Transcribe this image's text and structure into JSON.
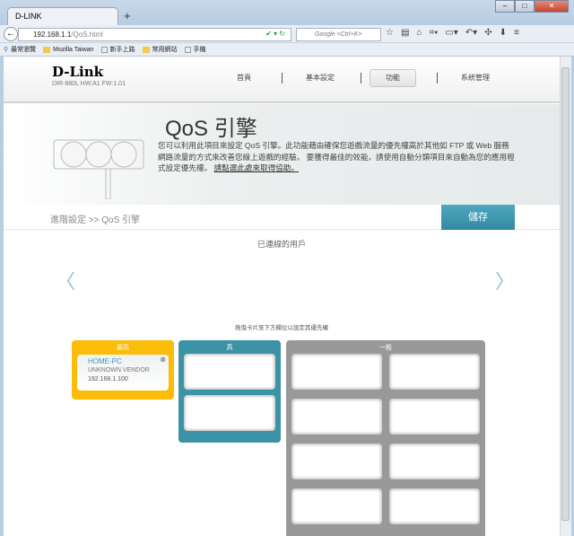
{
  "browser": {
    "tab_title": "D-LINK",
    "url_host": "192.168.1.1",
    "url_path": "/QoS.html",
    "search_placeholder": "Google <Ctrl+K>",
    "bookmarks": [
      "最常瀏覽",
      "Mozilla Taiwan",
      "新手上路",
      "常用網站",
      "手機"
    ]
  },
  "header": {
    "logo": "D-Link",
    "model": "DIR-880L   HW:A1   FW:1.01",
    "menu": [
      "首頁",
      "基本設定",
      "功能",
      "系統管理"
    ]
  },
  "banner": {
    "title": "QoS 引擎",
    "description": "您可以利用此項目來設定 QoS 引擎。此功能藉由確保您遊戲流量的優先權高於其他如 FTP 或 Web 服務網路流量的方式來改善您線上遊戲的經驗。 要獲得最佳的效能，請使用自動分類項目來自動為您的應用程式設定優先權。 ",
    "help_link": "請點選此處來取得協助。"
  },
  "breadcrumb": "進階設定 >> QoS 引擎",
  "save_label": "儲存",
  "connected_label": "已連線的用戶",
  "hint": "拖曳卡片至下方欄位以設定其優先權",
  "priorities": {
    "highest": {
      "label": "最高",
      "device": {
        "name": "HOME-PC",
        "vendor": "UNKNOWN VENDOR",
        "ip": "192.168.1.100"
      }
    },
    "high": {
      "label": "高"
    },
    "normal": {
      "label": "一般"
    }
  },
  "colors": {
    "highest": "#fbbd08",
    "high": "#3d93a6",
    "normal": "#999999",
    "accent": "#3d9ab2"
  }
}
